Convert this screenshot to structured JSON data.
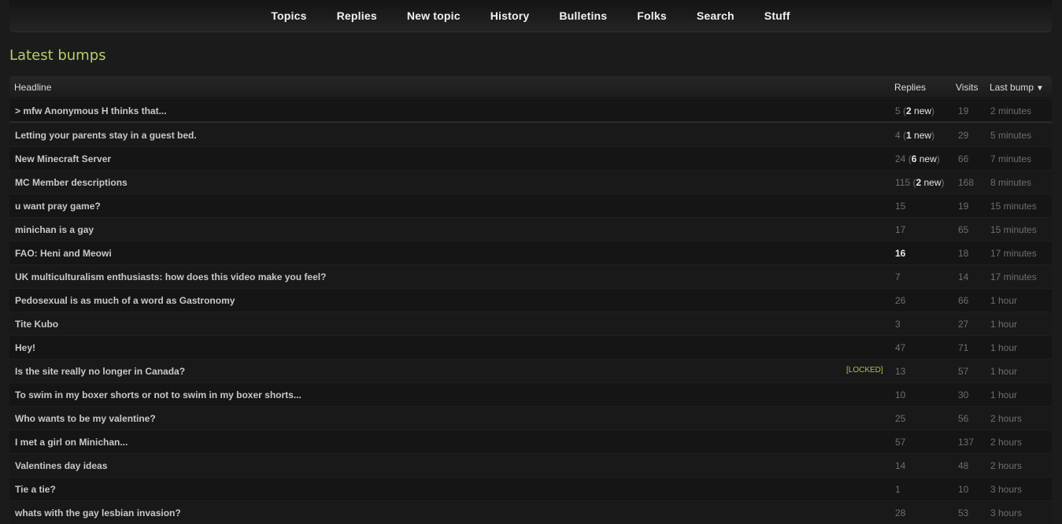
{
  "nav": {
    "items": [
      "Topics",
      "Replies",
      "New topic",
      "History",
      "Bulletins",
      "Folks",
      "Search",
      "Stuff"
    ]
  },
  "page": {
    "title": "Latest bumps"
  },
  "table": {
    "headers": {
      "headline": "Headline",
      "replies": "Replies",
      "visits": "Visits",
      "last_bump": "Last bump",
      "sort_indicator": "▼"
    },
    "locked_label": "[LOCKED]",
    "rows": [
      {
        "headline": "> mfw Anonymous H thinks that...",
        "replies": "5",
        "new": "2",
        "visits": "19",
        "bump": "2 minutes"
      },
      {
        "headline": "Letting your parents stay in a guest bed.",
        "replies": "4",
        "new": "1",
        "visits": "29",
        "bump": "5 minutes"
      },
      {
        "headline": "New Minecraft Server",
        "replies": "24",
        "new": "6",
        "visits": "66",
        "bump": "7 minutes"
      },
      {
        "headline": "MC Member descriptions",
        "replies": "115",
        "new": "2",
        "visits": "168",
        "bump": "8 minutes"
      },
      {
        "headline": "u want pray game?",
        "replies": "15",
        "visits": "19",
        "bump": "15 minutes"
      },
      {
        "headline": "minichan is a gay",
        "replies": "17",
        "visits": "65",
        "bump": "15 minutes"
      },
      {
        "headline": "FAO: Heni and Meowi",
        "replies": "16",
        "replies_bold": true,
        "visits": "18",
        "bump": "17 minutes"
      },
      {
        "headline": "UK multiculturalism enthusiasts: how does this video make you feel?",
        "replies": "7",
        "visits": "14",
        "bump": "17 minutes"
      },
      {
        "headline": "Pedosexual is as much of a word as Gastronomy",
        "replies": "26",
        "visits": "66",
        "bump": "1 hour"
      },
      {
        "headline": "Tite Kubo",
        "replies": "3",
        "visits": "27",
        "bump": "1 hour"
      },
      {
        "headline": "Hey!",
        "replies": "47",
        "visits": "71",
        "bump": "1 hour"
      },
      {
        "headline": "Is the site really no longer in Canada?",
        "locked": true,
        "replies": "13",
        "visits": "57",
        "bump": "1 hour"
      },
      {
        "headline": "To swim in my boxer shorts or not to swim in my boxer shorts...",
        "replies": "10",
        "visits": "30",
        "bump": "1 hour"
      },
      {
        "headline": "Who wants to be my valentine?",
        "replies": "25",
        "visits": "56",
        "bump": "2 hours"
      },
      {
        "headline": "I met a girl on Minichan...",
        "replies": "57",
        "visits": "137",
        "bump": "2 hours"
      },
      {
        "headline": "Valentines day ideas",
        "replies": "14",
        "visits": "48",
        "bump": "2 hours"
      },
      {
        "headline": "Tie a tie?",
        "replies": "1",
        "visits": "10",
        "bump": "3 hours"
      },
      {
        "headline": "whats with the gay lesbian invasion?",
        "replies": "28",
        "visits": "53",
        "bump": "3 hours"
      }
    ]
  },
  "colors": {
    "background": "#1b1b1b",
    "title_accent": "#b5cf6b",
    "locked_accent": "#a6c44a"
  }
}
